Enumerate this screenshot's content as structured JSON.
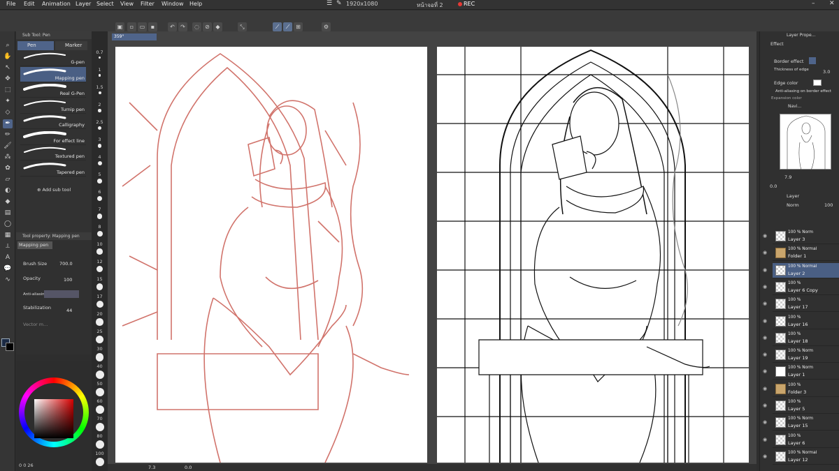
{
  "menu": [
    "File",
    "Edit",
    "Animation",
    "Layer",
    "Select",
    "View",
    "Filter",
    "Window",
    "Help"
  ],
  "title_info": {
    "resolution": "1920x1080",
    "doc": "หน้าจอที่ 2",
    "rec": "REC"
  },
  "doc_tab": {
    "label": "359°"
  },
  "subtool": {
    "header": "Sub Tool: Pen",
    "tabs": [
      "Pen",
      "Marker"
    ],
    "items": [
      {
        "label": "G-pen"
      },
      {
        "label": "Mapping pen"
      },
      {
        "label": "Real G-Pen"
      },
      {
        "label": "Turnip pen"
      },
      {
        "label": "Calligraphy"
      },
      {
        "label": "For effect line"
      },
      {
        "label": "Textured pen"
      },
      {
        "label": "Tapered pen"
      }
    ],
    "add": "Add sub tool"
  },
  "toolprop": {
    "header": "Tool property: Mapping pen",
    "name": "Mapping pen",
    "rows": [
      {
        "label": "Brush Size",
        "value": "700.0"
      },
      {
        "label": "Opacity",
        "value": "100"
      },
      {
        "label": "Anti-aliasing",
        "value": ""
      },
      {
        "label": "Stabilization",
        "value": "44"
      },
      {
        "label": "Vector m...",
        "value": ""
      }
    ]
  },
  "ruler": [
    "0.7",
    "1",
    "1.5",
    "2",
    "2.5",
    "3",
    "4",
    "5",
    "6",
    "7",
    "8",
    "10",
    "12",
    "15",
    "17",
    "20",
    "25",
    "30",
    "40",
    "50",
    "60",
    "70",
    "80",
    "100"
  ],
  "color": {
    "values": "0 0 26",
    "accent": "#4f648a"
  },
  "status": {
    "zoom": "7.3",
    "angle": "0.0"
  },
  "right": {
    "layer_prop": "Layer Prope...",
    "effect": "Effect",
    "border_effect": "Border effect",
    "thickness": "Thickness of edge",
    "thickness_val": "3.0",
    "edge_color": "Edge color",
    "aa_border": "Anti-aliasing on border effect",
    "expansion": "Expansion color",
    "navigator": "Navi...",
    "nav_zoom": "7.9",
    "nav_angle": "0.0",
    "layer_tab": "Layer",
    "blend": "Norm",
    "opacity": "100",
    "layers": [
      {
        "pct": "100 % Norm",
        "name": "Layer 3",
        "type": "c"
      },
      {
        "pct": "100 % Normal",
        "name": "Folder 1",
        "type": "f"
      },
      {
        "pct": "100 % Normal",
        "name": "Layer 2",
        "type": "c",
        "sel": true
      },
      {
        "pct": "100 %",
        "name": "Layer 6 Copy",
        "type": "c"
      },
      {
        "pct": "100 %",
        "name": "Layer 17",
        "type": "c"
      },
      {
        "pct": "100 %",
        "name": "Layer 16",
        "type": "c"
      },
      {
        "pct": "100 %",
        "name": "Layer 18",
        "type": "c"
      },
      {
        "pct": "100 % Norm",
        "name": "Layer 19",
        "type": "c"
      },
      {
        "pct": "100 % Norm",
        "name": "Layer 1",
        "type": "w"
      },
      {
        "pct": "100 %",
        "name": "Folder 3",
        "type": "f"
      },
      {
        "pct": "100 %",
        "name": "Layer 5",
        "type": "c"
      },
      {
        "pct": "100 % Norm",
        "name": "Layer 15",
        "type": "c"
      },
      {
        "pct": "100 %",
        "name": "Layer 6",
        "type": "c"
      },
      {
        "pct": "100 % Normal",
        "name": "Layer 12",
        "type": "c"
      }
    ]
  }
}
